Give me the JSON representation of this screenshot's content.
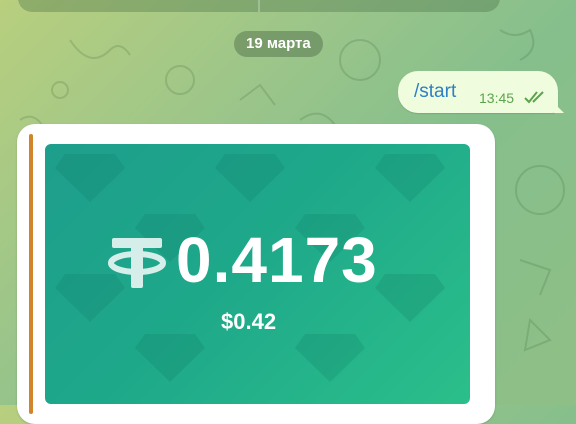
{
  "chat": {
    "date_label": "19 марта",
    "outgoing": {
      "text": "/start",
      "time": "13:45",
      "status_icon": "double-check-icon"
    },
    "incoming": {
      "card": {
        "amount": "0.4173",
        "usd_value": "$0.42",
        "currency_icon": "tether-icon"
      }
    }
  },
  "colors": {
    "outgoing_bubble": "#effdde",
    "command_text": "#2d7ec7",
    "time_text": "#5da34e",
    "accent_bar": "#d1852a",
    "card_gradient_start": "#1e9e8c",
    "card_gradient_end": "#2bbf8a"
  }
}
